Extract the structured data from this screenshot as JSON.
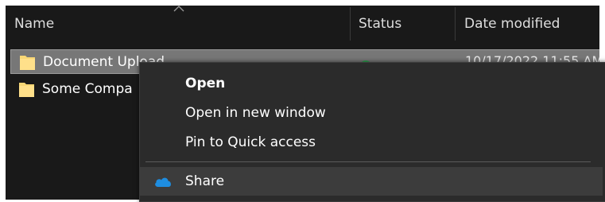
{
  "header": {
    "columns": [
      {
        "label": "Name"
      },
      {
        "label": "Status"
      },
      {
        "label": "Date modified"
      }
    ],
    "sort_indicator": "chevron-up-icon"
  },
  "files": [
    {
      "name": "Document Upload",
      "icon": "folder-icon",
      "status_icon": "synced-check-icon",
      "date_modified": "10/17/2022 11:55 AM",
      "selected": true
    },
    {
      "name": "Some Compa",
      "icon": "folder-icon",
      "status_icon": "",
      "date_modified": "",
      "selected": false
    }
  ],
  "context_menu": {
    "items": [
      {
        "label": "Open",
        "bold": true
      },
      {
        "label": "Open in new window",
        "bold": false
      },
      {
        "label": "Pin to Quick access",
        "bold": false
      },
      {
        "label": "Share",
        "bold": false,
        "icon": "onedrive-cloud-icon",
        "highlighted": true
      }
    ]
  },
  "colors": {
    "background": "#191919",
    "selection": "#777777",
    "menu_background": "#2b2b2b",
    "menu_hover": "#3c3c3c",
    "folder": "#f8d775",
    "onedrive_blue": "#1e8de0",
    "status_green": "#2e9e4f"
  }
}
